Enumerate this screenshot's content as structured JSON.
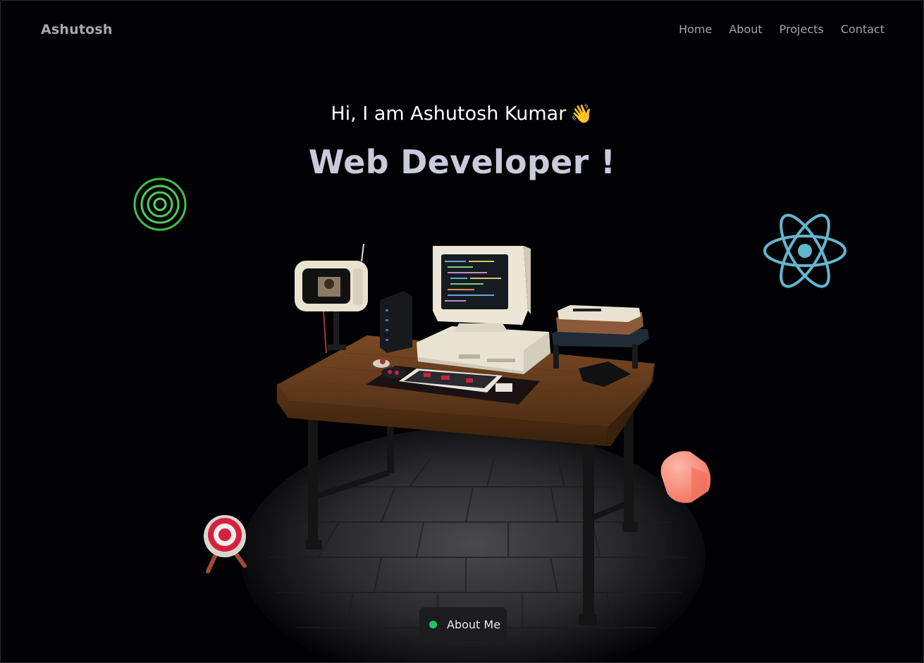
{
  "brand": "Ashutosh",
  "nav": {
    "items": [
      {
        "label": "Home"
      },
      {
        "label": "About"
      },
      {
        "label": "Projects"
      },
      {
        "label": "Contact"
      }
    ]
  },
  "hero": {
    "greeting": "Hi, I am Ashutosh Kumar",
    "wave_emoji": "👋",
    "headline": "Web Developer !"
  },
  "cta": {
    "label": "About Me",
    "status_color": "#22c55e"
  },
  "icons": {
    "rings": "concentric-rings-icon",
    "react": "react-logo-icon",
    "cube": "cube-icon",
    "target": "target-icon"
  },
  "colors": {
    "background": "#010103",
    "headline": "#c9cbdb",
    "nav_text": "#a3a3aa",
    "react_blue": "#61b6cf",
    "rings_green": "#3fbf4a",
    "cube_coral": "#ff8a75"
  }
}
